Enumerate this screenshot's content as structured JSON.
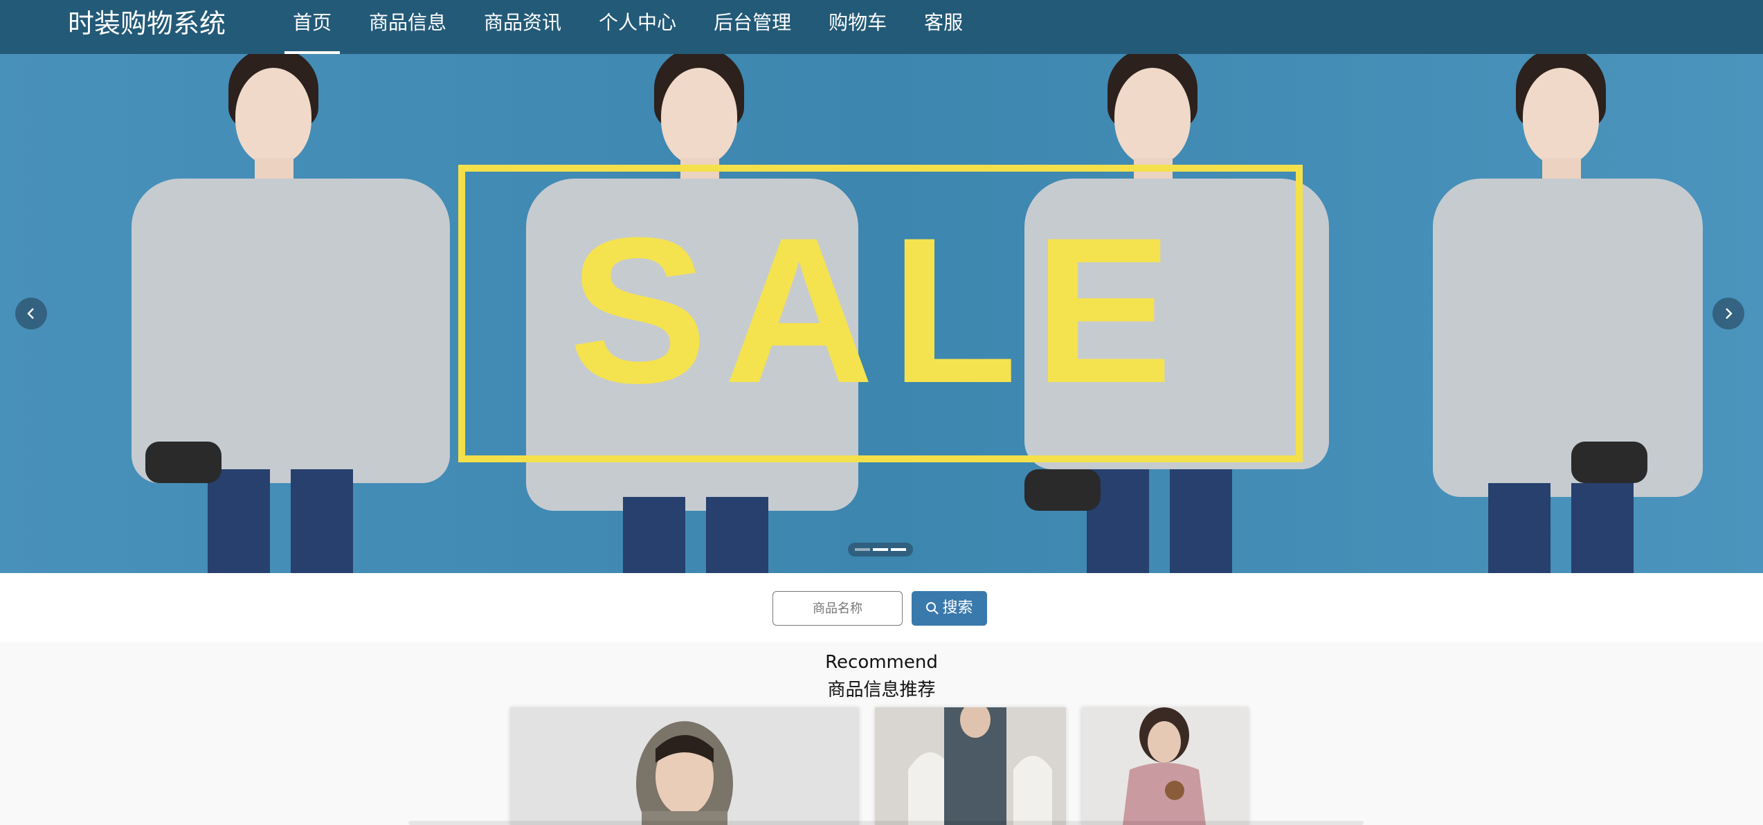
{
  "header": {
    "brand": "时装购物系统",
    "nav": [
      {
        "label": "首页",
        "active": true
      },
      {
        "label": "商品信息",
        "active": false
      },
      {
        "label": "商品资讯",
        "active": false
      },
      {
        "label": "个人中心",
        "active": false
      },
      {
        "label": "后台管理",
        "active": false
      },
      {
        "label": "购物车",
        "active": false
      },
      {
        "label": "客服",
        "active": false
      }
    ]
  },
  "banner": {
    "sale_text": "SALE",
    "prev_icon": "chevron-left-icon",
    "next_icon": "chevron-right-icon",
    "slides": 3,
    "active_slide": 2,
    "colors": {
      "background": "#3e88b1",
      "sale_yellow": "#f5e24f"
    }
  },
  "search": {
    "placeholder": "商品名称",
    "value": "",
    "button_label": "搜索",
    "button_icon": "search-icon"
  },
  "recommend": {
    "title_en": "Recommend",
    "title_zh": "商品信息推荐"
  },
  "colors": {
    "header_bg": "#235a78",
    "button_bg": "#3a79ac"
  }
}
